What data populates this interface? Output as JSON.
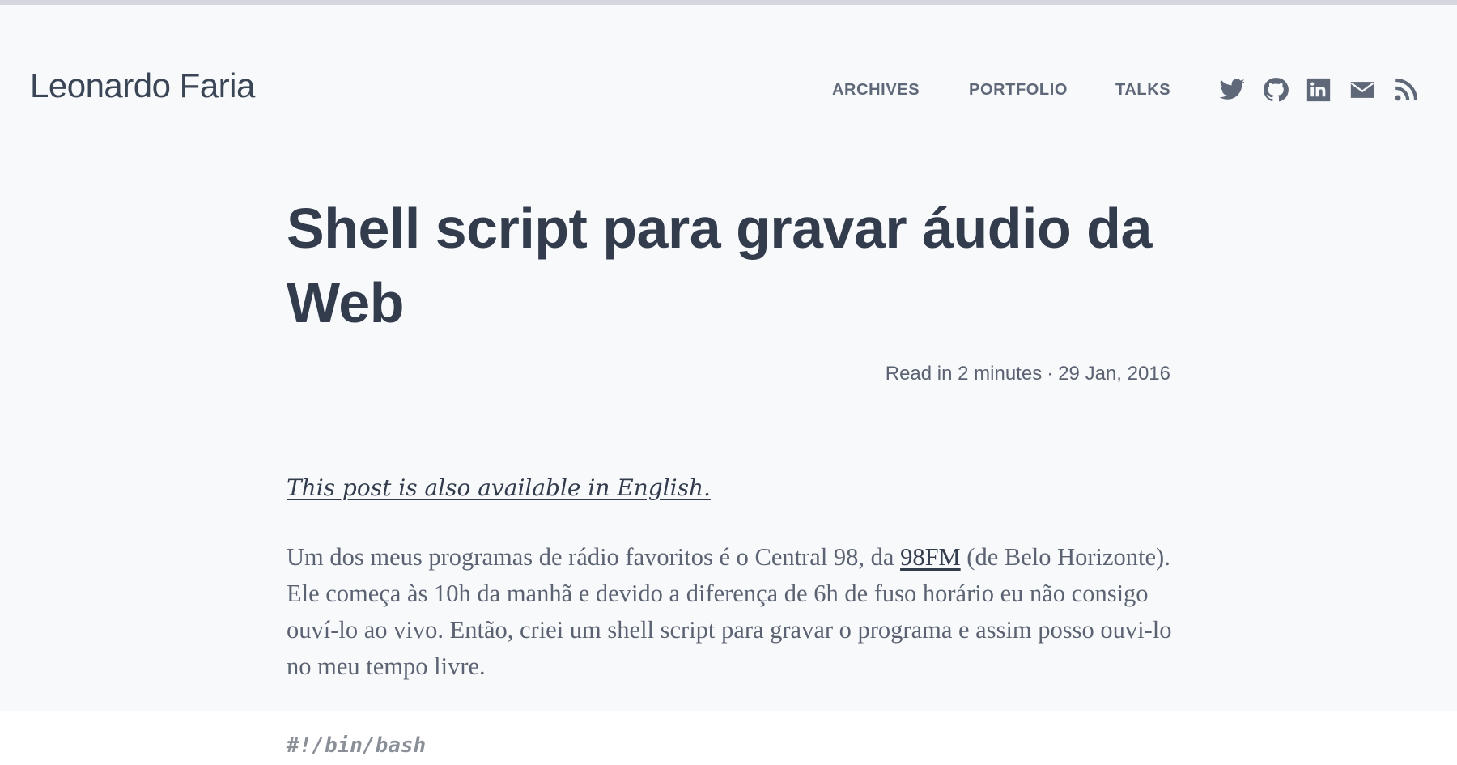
{
  "site": {
    "title": "Leonardo Faria"
  },
  "nav": {
    "items": [
      {
        "label": "ARCHIVES"
      },
      {
        "label": "PORTFOLIO"
      },
      {
        "label": "TALKS"
      }
    ],
    "social": [
      {
        "icon": "twitter-icon"
      },
      {
        "icon": "github-icon"
      },
      {
        "icon": "linkedin-icon"
      },
      {
        "icon": "mail-icon"
      },
      {
        "icon": "rss-icon"
      }
    ]
  },
  "post": {
    "title": "Shell script para gravar áudio da Web",
    "read_time": "Read in 2 minutes",
    "separator": "·",
    "date": "29 Jan, 2016",
    "lang_note": "This post is also available in English.",
    "paragraph": {
      "before_link": "Um dos meus programas de rádio favoritos é o Central 98, da ",
      "link": "98FM",
      "after_link": " (de Belo Horizonte). Ele começa às 10h da manhã e devido a diferença de 6h de fuso horário eu não consigo ouví-lo ao vivo. Então, criei um shell script para gravar o programa e assim posso ouvi-lo no meu tempo livre."
    },
    "code_first_line": "#!/bin/bash"
  },
  "colors": {
    "background": "#f8f9fb",
    "heading": "#323c4d",
    "body_text": "#5b6373",
    "nav_text": "#5f6878",
    "code_background": "#ffffff"
  }
}
